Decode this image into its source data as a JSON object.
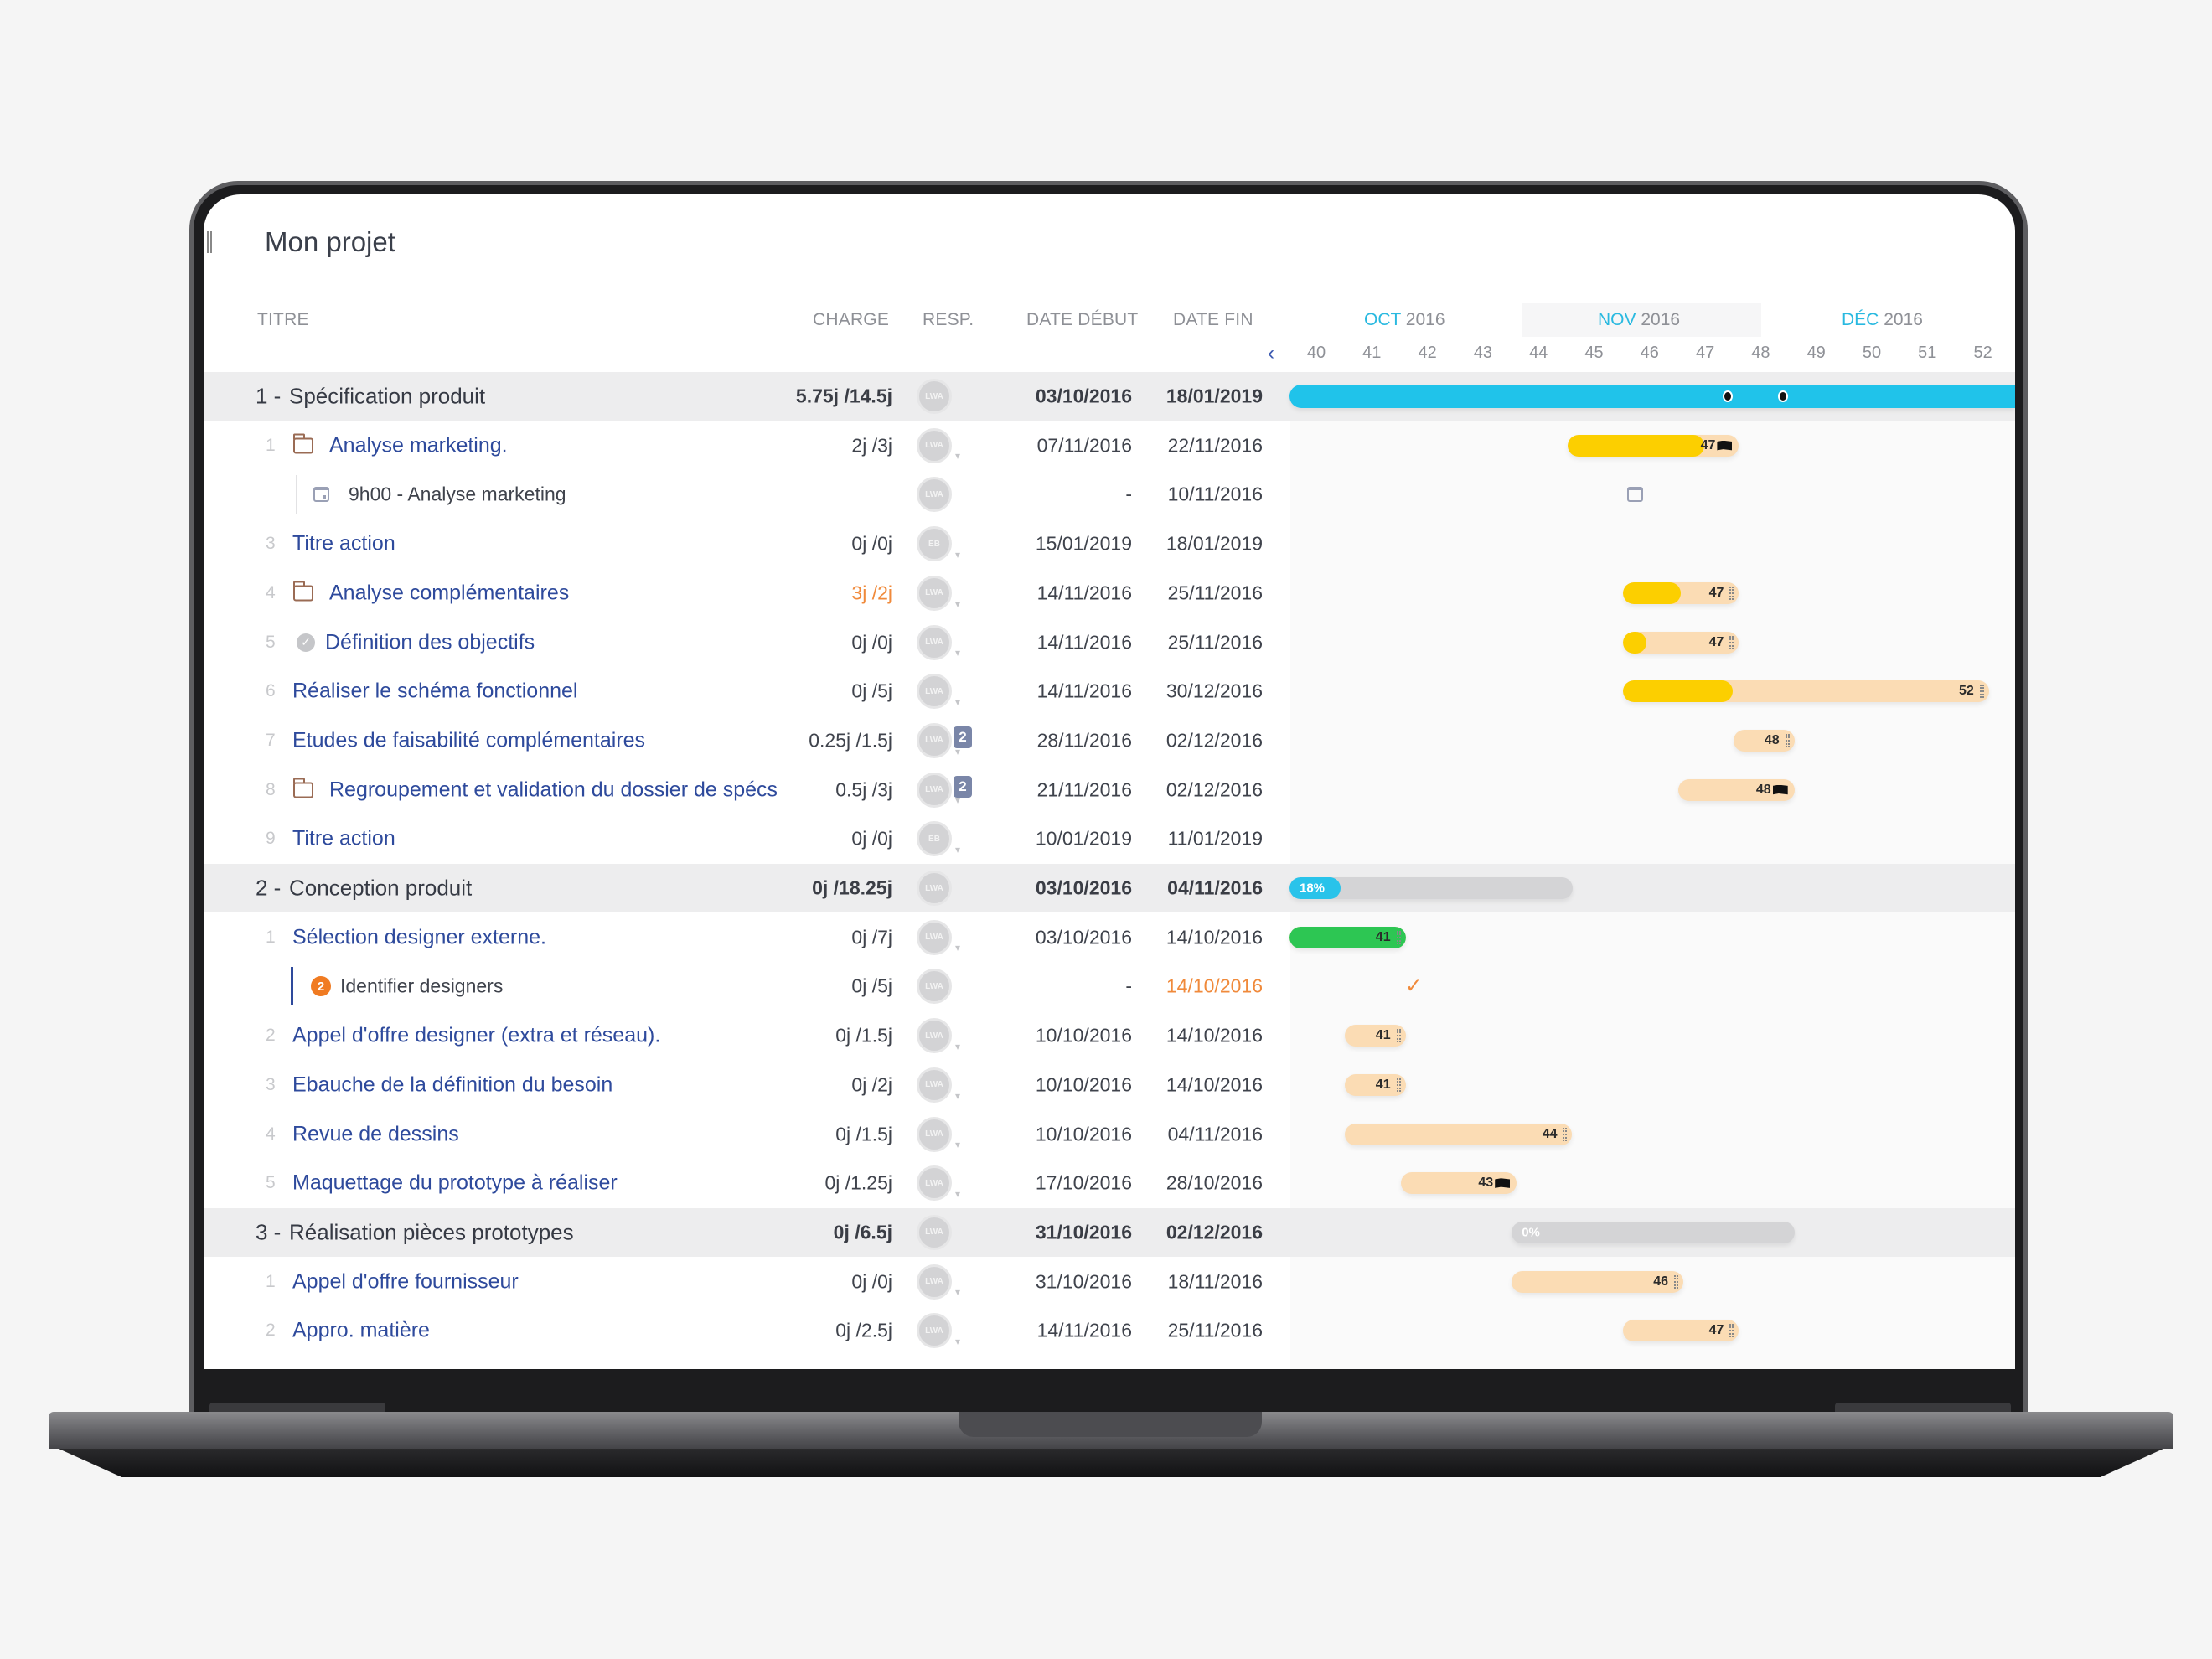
{
  "app": {
    "title": "Mon projet"
  },
  "columns": {
    "title": "TITRE",
    "charge": "CHARGE",
    "resp": "RESP.",
    "start": "DATE DÉBUT",
    "end": "DATE FIN"
  },
  "timeline": {
    "prev_icon": "chevron-left-icon",
    "months": [
      {
        "name": "OCT",
        "year": "2016"
      },
      {
        "name": "NOV",
        "year": "2016"
      },
      {
        "name": "DÉC",
        "year": "2016"
      }
    ],
    "weeks": [
      "40",
      "41",
      "42",
      "43",
      "44",
      "45",
      "46",
      "47",
      "48",
      "49",
      "50",
      "51",
      "52"
    ]
  },
  "colors": {
    "accent_blue": "#29c3ea",
    "link_blue": "#2e4a9c",
    "progress_yellow": "#fccf00",
    "progress_green": "#2dc653",
    "bar_peach": "#fbdcb4",
    "warning_orange": "#f08a3b"
  },
  "rows": [
    {
      "type": "group",
      "num": "1 -",
      "title": "Spécification produit",
      "charge": "5.75j /14.5j",
      "avatar": "LWA",
      "start": "03/10/2016",
      "end": "18/01/2019",
      "bar": {
        "kind": "full",
        "from_week": 40,
        "to_week": 53.3,
        "milestones_weeks": [
          47.4,
          48.4
        ]
      }
    },
    {
      "type": "task",
      "num": "1",
      "icon": "folder-icon",
      "title": "Analyse marketing.",
      "charge": "2j /3j",
      "avatar": "LWA",
      "start": "07/11/2016",
      "end": "22/11/2016",
      "bar": {
        "kind": "task",
        "from_week": 45,
        "to_week": 48,
        "progress": 0.8,
        "fill": "yellow",
        "label": "47",
        "end_icon": "flag-icon"
      }
    },
    {
      "type": "sub",
      "icon": "calendar-icon",
      "title": "9h00 - Analyse marketing",
      "charge": "",
      "avatar": "LWA",
      "start": "-",
      "end": "10/11/2016",
      "bar": {
        "kind": "calendar",
        "at_week": 45.6
      }
    },
    {
      "type": "task",
      "num": "3",
      "title": "Titre action",
      "charge": "0j /0j",
      "avatar": "EB",
      "start": "15/01/2019",
      "end": "18/01/2019"
    },
    {
      "type": "task",
      "num": "4",
      "icon": "folder-icon",
      "title": "Analyse complémentaires",
      "charge": "3j /2j",
      "charge_over": true,
      "avatar": "LWA",
      "start": "14/11/2016",
      "end": "25/11/2016",
      "bar": {
        "kind": "task",
        "from_week": 46,
        "to_week": 48,
        "progress": 0.5,
        "fill": "yellow",
        "label": "47",
        "end_icon": "drag-handle-icon"
      }
    },
    {
      "type": "task",
      "num": "5",
      "icon": "check-circle-icon",
      "title": "Définition des objectifs",
      "charge": "0j /0j",
      "avatar": "LWA",
      "start": "14/11/2016",
      "end": "25/11/2016",
      "bar": {
        "kind": "task",
        "from_week": 46,
        "to_week": 48,
        "progress": 0.2,
        "fill": "yellow",
        "label": "47",
        "end_icon": "drag-handle-icon"
      }
    },
    {
      "type": "task",
      "num": "6",
      "title": "Réaliser le schéma fonctionnel",
      "charge": "0j /5j",
      "avatar": "LWA",
      "start": "14/11/2016",
      "end": "30/12/2016",
      "bar": {
        "kind": "task",
        "from_week": 46,
        "to_week": 52.5,
        "progress": 0.3,
        "fill": "yellow",
        "label": "52",
        "end_icon": "drag-handle-icon"
      }
    },
    {
      "type": "task",
      "num": "7",
      "title": "Etudes de faisabilité complémentaires",
      "charge": "0.25j /1.5j",
      "avatar": "LWA",
      "badge": "2",
      "start": "28/11/2016",
      "end": "02/12/2016",
      "bar": {
        "kind": "task",
        "from_week": 48,
        "to_week": 49,
        "progress": 0,
        "label": "48",
        "end_icon": "drag-handle-icon"
      }
    },
    {
      "type": "task",
      "num": "8",
      "icon": "folder-icon",
      "title": "Regroupement et validation du dossier de spécs",
      "charge": "0.5j /3j",
      "avatar": "LWA",
      "badge": "2",
      "start": "21/11/2016",
      "end": "02/12/2016",
      "bar": {
        "kind": "task",
        "from_week": 47,
        "to_week": 49,
        "progress": 0,
        "label": "48",
        "end_icon": "flag-icon"
      }
    },
    {
      "type": "task",
      "num": "9",
      "title": "Titre action",
      "charge": "0j /0j",
      "avatar": "EB",
      "start": "10/01/2019",
      "end": "11/01/2019"
    },
    {
      "type": "group",
      "num": "2 -",
      "title": "Conception produit",
      "charge": "0j /18.25j",
      "avatar": "LWA",
      "start": "03/10/2016",
      "end": "04/11/2016",
      "bar": {
        "kind": "summary",
        "from_week": 40,
        "to_week": 45,
        "progress": 0.18,
        "label": "18%"
      }
    },
    {
      "type": "task",
      "num": "1",
      "title": "Sélection designer externe.",
      "charge": "0j /7j",
      "avatar": "LWA",
      "start": "03/10/2016",
      "end": "14/10/2016",
      "bar": {
        "kind": "task",
        "from_week": 40,
        "to_week": 42,
        "progress": 1,
        "fill": "green",
        "label": "41",
        "end_icon": "drag-handle-icon"
      }
    },
    {
      "type": "sub-blue",
      "icon": "numbered-badge-icon",
      "icon_text": "2",
      "title": "Identifier designers",
      "charge": "0j /5j",
      "avatar": "LWA",
      "start": "-",
      "end": "14/10/2016",
      "end_late": true,
      "bar": {
        "kind": "check",
        "at_week": 41.6
      }
    },
    {
      "type": "task",
      "num": "2",
      "title": "Appel d'offre designer (extra et réseau).",
      "charge": "0j /1.5j",
      "avatar": "LWA",
      "start": "10/10/2016",
      "end": "14/10/2016",
      "bar": {
        "kind": "task",
        "from_week": 41,
        "to_week": 42,
        "progress": 0,
        "label": "41",
        "end_icon": "drag-handle-icon"
      }
    },
    {
      "type": "task",
      "num": "3",
      "title": "Ebauche de la définition du besoin",
      "charge": "0j /2j",
      "avatar": "LWA",
      "start": "10/10/2016",
      "end": "14/10/2016",
      "bar": {
        "kind": "task",
        "from_week": 41,
        "to_week": 42,
        "progress": 0,
        "label": "41",
        "end_icon": "drag-handle-icon"
      }
    },
    {
      "type": "task",
      "num": "4",
      "title": "Revue de dessins",
      "charge": "0j /1.5j",
      "avatar": "LWA",
      "start": "10/10/2016",
      "end": "04/11/2016",
      "bar": {
        "kind": "task",
        "from_week": 41,
        "to_week": 45,
        "progress": 0,
        "label": "44",
        "end_icon": "drag-handle-icon"
      }
    },
    {
      "type": "task",
      "num": "5",
      "title": "Maquettage du prototype à réaliser",
      "charge": "0j /1.25j",
      "avatar": "LWA",
      "start": "17/10/2016",
      "end": "28/10/2016",
      "bar": {
        "kind": "task",
        "from_week": 42,
        "to_week": 44,
        "progress": 0,
        "label": "43",
        "end_icon": "flag-icon"
      }
    },
    {
      "type": "group",
      "num": "3 -",
      "title": "Réalisation pièces prototypes",
      "charge": "0j /6.5j",
      "avatar": "LWA",
      "start": "31/10/2016",
      "end": "02/12/2016",
      "bar": {
        "kind": "summary",
        "from_week": 44,
        "to_week": 49,
        "progress": 0,
        "label": "0%"
      }
    },
    {
      "type": "task",
      "num": "1",
      "title": "Appel d'offre fournisseur",
      "charge": "0j /0j",
      "avatar": "LWA",
      "start": "31/10/2016",
      "end": "18/11/2016",
      "bar": {
        "kind": "task",
        "from_week": 44,
        "to_week": 47,
        "progress": 0,
        "label": "46",
        "end_icon": "drag-handle-icon"
      }
    },
    {
      "type": "task",
      "num": "2",
      "title": "Appro. matière",
      "charge": "0j /2.5j",
      "avatar": "LWA",
      "start": "14/11/2016",
      "end": "25/11/2016",
      "bar": {
        "kind": "task",
        "from_week": 46,
        "to_week": 48,
        "progress": 0,
        "label": "47",
        "end_icon": "drag-handle-icon"
      }
    }
  ]
}
